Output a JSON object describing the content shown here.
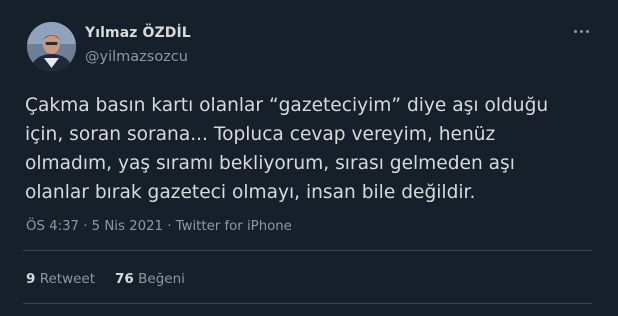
{
  "user": {
    "name": "Yılmaz ÖZDİL",
    "handle": "@yilmazsozcu"
  },
  "tweet": {
    "text": "Çakma basın kartı olanlar “gazeteciyim” diye aşı olduğu\niçin, soran sorana... Topluca cevap vereyim, henüz\nolmadım, yaş sıramı bekliyorum, sırası gelmeden aşı\nolanlar bırak gazeteci olmayı, insan bile değildir.",
    "meta": "ÖS 4:37 · 5 Nis 2021 · Twitter for iPhone"
  },
  "stats": {
    "retweets_count": "9",
    "retweets_label": "Retweet",
    "likes_count": "76",
    "likes_label": "Beğeni"
  },
  "icons": {
    "more": "more-horizontal-icon"
  },
  "colors": {
    "background": "#15202b",
    "primary_text": "#d9d9d9",
    "secondary_text": "#8b98a5",
    "divider": "#38444d"
  }
}
